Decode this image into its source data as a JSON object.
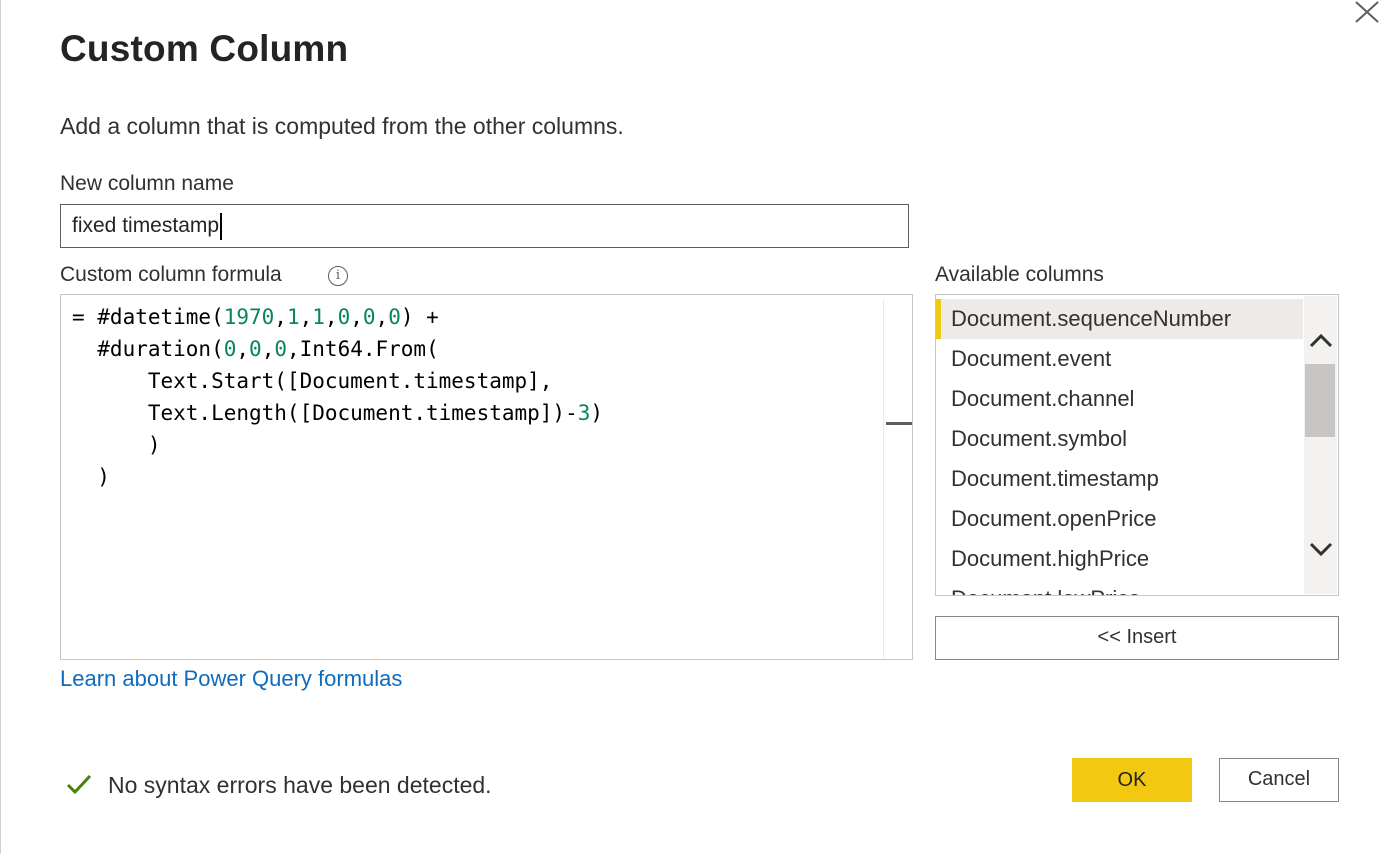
{
  "dialog": {
    "title": "Custom Column",
    "subtitle": "Add a column that is computed from the other columns."
  },
  "name_field": {
    "label": "New column name",
    "value": "fixed timestamp"
  },
  "formula_field": {
    "label": "Custom column formula",
    "lines": [
      "= #datetime(1970,1,1,0,0,0) +",
      "  #duration(0,0,0,Int64.From(",
      "      Text.Start([Document.timestamp],",
      "      Text.Length([Document.timestamp])-3)",
      "      )",
      "  )"
    ],
    "number_color": "#098658"
  },
  "available_columns": {
    "label": "Available columns",
    "items": [
      "Document.sequenceNumber",
      "Document.event",
      "Document.channel",
      "Document.symbol",
      "Document.timestamp",
      "Document.openPrice",
      "Document.highPrice",
      "Document.lowPrice"
    ],
    "selected_index": 0,
    "insert_label": "<< Insert"
  },
  "learn_link": "Learn about Power Query formulas",
  "status": {
    "icon": "checkmark-icon",
    "text": "No syntax errors have been detected.",
    "color": "#498205"
  },
  "buttons": {
    "ok_label": "OK",
    "cancel_label": "Cancel"
  },
  "colors": {
    "accent": "#f2c811",
    "link": "#0f6cbd"
  }
}
